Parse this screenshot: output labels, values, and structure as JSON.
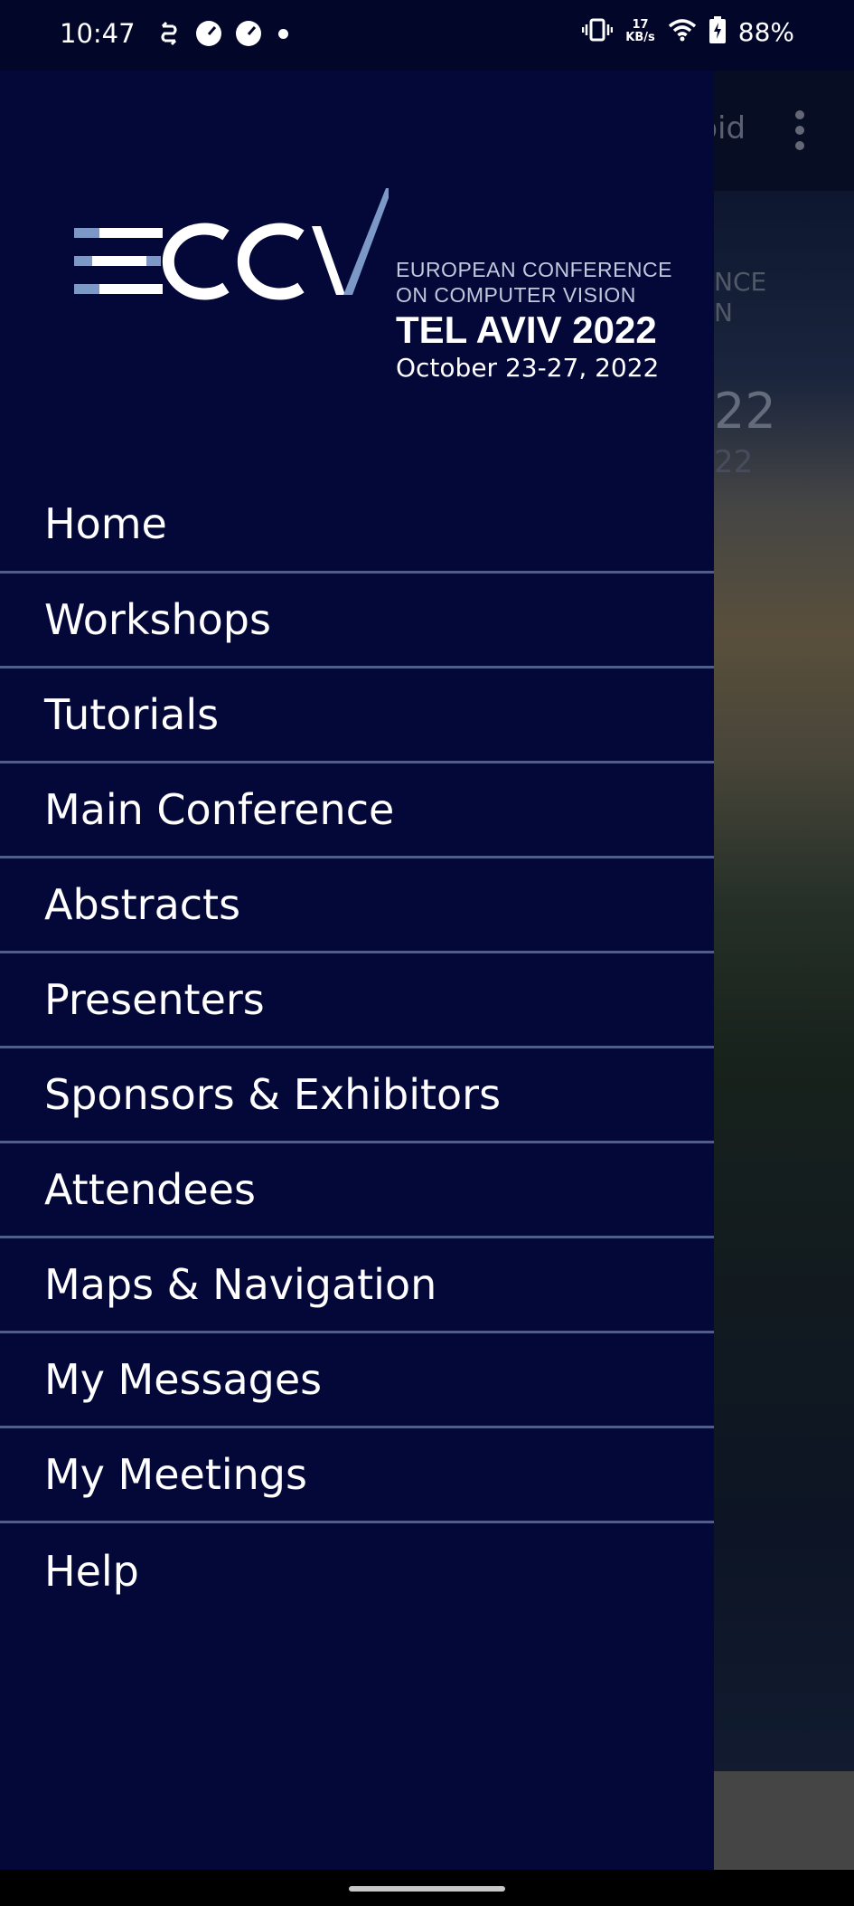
{
  "status_bar": {
    "time": "10:47",
    "net_speed_value": "17",
    "net_speed_unit": "KB/s",
    "battery": "88%"
  },
  "background_app": {
    "toolbar_title_partial": "roid",
    "hero_line1": "NCE",
    "hero_line2": "N",
    "hero_line3": "22",
    "hero_line4": "22"
  },
  "drawer": {
    "logo": {
      "mark": "ECCV",
      "line1": "EUROPEAN CONFERENCE",
      "line2": "ON COMPUTER VISION",
      "city": "TEL AVIV 2022",
      "dates": "October 23-27, 2022"
    },
    "menu": [
      {
        "label": "Home"
      },
      {
        "label": "Workshops"
      },
      {
        "label": "Tutorials"
      },
      {
        "label": "Main Conference"
      },
      {
        "label": "Abstracts"
      },
      {
        "label": "Presenters"
      },
      {
        "label": "Sponsors & Exhibitors"
      },
      {
        "label": "Attendees"
      },
      {
        "label": "Maps & Navigation"
      },
      {
        "label": "My Messages"
      },
      {
        "label": "My Meetings"
      },
      {
        "label": "Help"
      }
    ]
  },
  "colors": {
    "drawer_bg": "#030839",
    "divider": "#4e5d8c",
    "logo_accent": "#7c98c6"
  }
}
